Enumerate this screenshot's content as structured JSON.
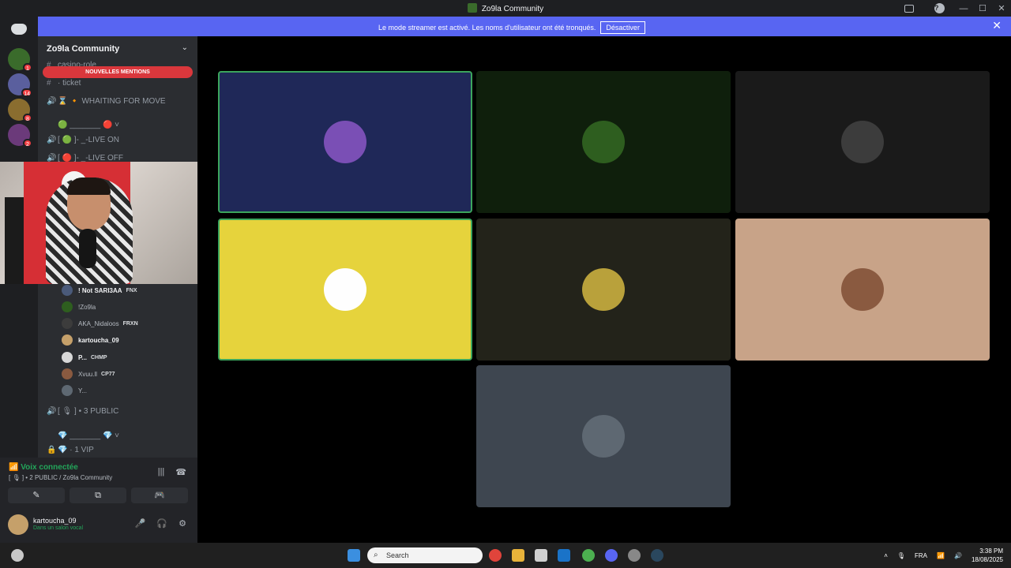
{
  "titlebar": {
    "title": "Zo9la Community"
  },
  "banner": {
    "text": "Le mode streamer est activé. Les noms d'utilisateur ont été tronqués.",
    "button": "Désactiver",
    "close": "✕"
  },
  "guilds": [
    {
      "badge": "1",
      "color": "#3a6b2b"
    },
    {
      "badge": "14",
      "color": "#5a5f9e"
    },
    {
      "badge": "8",
      "color": "#8a6d2f"
    },
    {
      "badge": "2",
      "color": "#6b3a7a"
    }
  ],
  "server": {
    "name": "Zo9la Community",
    "new_mentions": "NOUVELLES MENTIONS"
  },
  "channels": [
    {
      "icon": "#",
      "label": "casino-role"
    },
    {
      "icon": "#",
      "label": "· ticket"
    },
    {
      "icon": "🔊",
      "label": "⌛ 🔸 WHAITING FOR MOVE"
    },
    {
      "icon": "",
      "label": "🟢 _______ 🔴 ˅"
    },
    {
      "icon": "🔊",
      "label": "[ 🟢 ]- _-LIVE ON"
    },
    {
      "icon": "🔊",
      "label": "[ 🔴 ]- _-LIVE OFF"
    }
  ],
  "members": [
    {
      "name": "! Not SARI3AA",
      "tag": "FNX",
      "bold": true
    },
    {
      "name": "!Zo9la",
      "tag": ""
    },
    {
      "name": "AKA_Nidaloos",
      "tag": "FRXN"
    },
    {
      "name": "kartoucha_09",
      "tag": "",
      "bold": true
    },
    {
      "name": "P...",
      "tag": "CHMP",
      "bold": true
    },
    {
      "name": "Xvuu.ll",
      "tag": "CP77"
    },
    {
      "name": "Y...",
      "tag": ""
    }
  ],
  "channels_lower": [
    {
      "icon": "🔊",
      "label": "[ 🎙 ] • 3 PUBLIC"
    },
    {
      "icon": "",
      "label": "💎 _______ 💎 ˅"
    },
    {
      "icon": "🔒",
      "label": "💎 · 1 VIP"
    }
  ],
  "voice": {
    "status": "Voix connectée",
    "channel": "[ 🎙 ] • 2 PUBLIC / Zo9la Community"
  },
  "user": {
    "name": "kartoucha_09",
    "status": "Dans un salon vocal"
  },
  "tiles": [
    {
      "bg": "#1f2858",
      "avatar": "#7a4fb5",
      "speaking": true
    },
    {
      "bg": "#0f1f0c",
      "avatar": "#2e5e1f",
      "speaking": false
    },
    {
      "bg": "#1a1a1a",
      "avatar": "#3c3c3c",
      "speaking": false
    },
    {
      "bg": "#e6d33c",
      "avatar": "#fefefe",
      "speaking": true
    },
    {
      "bg": "#23231a",
      "avatar": "#b9a13b",
      "speaking": false
    },
    {
      "bg": "#c8a388",
      "avatar": "#8a5a40",
      "speaking": false
    },
    {
      "bg": "#3e4650",
      "avatar": "#5e6872",
      "speaking": false
    }
  ],
  "taskbar": {
    "search": "Search",
    "lang": "FRA",
    "time": "3:38 PM",
    "date": "18/08/2025"
  }
}
